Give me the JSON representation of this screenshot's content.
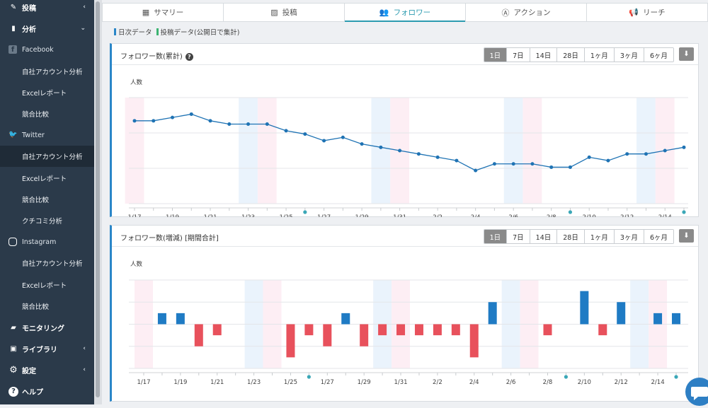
{
  "sidebar": {
    "items": [
      {
        "kind": "top",
        "icon": "pencil-icon",
        "label": "投稿",
        "chevron": "‹"
      },
      {
        "kind": "top",
        "icon": "bar-chart-icon",
        "label": "分析",
        "chevron": "⌄"
      },
      {
        "kind": "sec",
        "icon": "facebook-icon",
        "label": "Facebook",
        "color": "#3b5998"
      },
      {
        "kind": "sub",
        "label": "自社アカウント分析"
      },
      {
        "kind": "sub",
        "label": "Excelレポート"
      },
      {
        "kind": "sub",
        "label": "競合比較"
      },
      {
        "kind": "sec",
        "icon": "twitter-icon",
        "label": "Twitter",
        "color": "#5a6b7c"
      },
      {
        "kind": "sub",
        "label": "自社アカウント分析",
        "active": true
      },
      {
        "kind": "sub",
        "label": "Excelレポート"
      },
      {
        "kind": "sub",
        "label": "競合比較"
      },
      {
        "kind": "sub",
        "label": "クチコミ分析"
      },
      {
        "kind": "sec",
        "icon": "instagram-icon",
        "label": "Instagram",
        "color": "#2b3a4a"
      },
      {
        "kind": "sub",
        "label": "自社アカウント分析"
      },
      {
        "kind": "sub",
        "label": "Excelレポート"
      },
      {
        "kind": "sub",
        "label": "競合比較"
      },
      {
        "kind": "top",
        "icon": "chat-icon",
        "label": "モニタリング",
        "chevron": ""
      },
      {
        "kind": "top",
        "icon": "book-icon",
        "label": "ライブラリ",
        "chevron": "‹"
      },
      {
        "kind": "top",
        "icon": "gear-icon",
        "label": "設定",
        "chevron": "‹"
      },
      {
        "kind": "top",
        "icon": "question-icon",
        "label": "ヘルプ",
        "chevron": ""
      }
    ]
  },
  "tabs": [
    {
      "icon": "grid-icon",
      "glyph": "▦",
      "label": "サマリー"
    },
    {
      "icon": "image-icon",
      "glyph": "▨",
      "label": "投稿"
    },
    {
      "icon": "users-icon",
      "glyph": "👥",
      "label": "フォロワー",
      "active": true
    },
    {
      "icon": "action-icon",
      "glyph": "Ⓐ",
      "label": "アクション"
    },
    {
      "icon": "megaphone-icon",
      "glyph": "📢",
      "label": "リーチ"
    }
  ],
  "legend": [
    {
      "label": "日次データ",
      "color": "#2a86c8"
    },
    {
      "label": "投稿データ(公開日で集計)",
      "color": "#3cb371"
    }
  ],
  "periods": [
    "1日",
    "7日",
    "14日",
    "28日",
    "1ヶ月",
    "3ヶ月",
    "6ヶ月"
  ],
  "active_period": "1日",
  "colors": {
    "accent": "#2c9bb0",
    "line": "#1f73b4",
    "bar_pos": "#1f7bc4",
    "bar_neg": "#e8515c",
    "weekend_sat": "#eaf3fc",
    "weekend_sun": "#fdeef4",
    "marker": "#3aa7b7"
  },
  "panel1": {
    "title": "フォロワー数(累計)",
    "ylabel": "人数"
  },
  "panel2": {
    "title": "フォロワー数(増減) [期間合計]",
    "ylabel": "人数"
  },
  "chart_data": [
    {
      "type": "line",
      "title": "フォロワー数(累計)",
      "ylabel": "人数",
      "x": [
        "1/17",
        "1/18",
        "1/19",
        "1/20",
        "1/21",
        "1/22",
        "1/23",
        "1/24",
        "1/25",
        "1/26",
        "1/27",
        "1/28",
        "1/29",
        "1/30",
        "1/31",
        "2/1",
        "2/2",
        "2/3",
        "2/4",
        "2/5",
        "2/6",
        "2/7",
        "2/8",
        "2/9",
        "2/10",
        "2/11",
        "2/12",
        "2/13",
        "2/14",
        "2/15"
      ],
      "tick_labels": [
        "1/17",
        "1/19",
        "1/21",
        "1/23",
        "1/25",
        "1/27",
        "1/29",
        "1/31",
        "2/2",
        "2/4",
        "2/6",
        "2/8",
        "2/10",
        "2/12",
        "2/14"
      ],
      "values": [
        0.75,
        0.75,
        0.76,
        0.77,
        0.75,
        0.74,
        0.74,
        0.74,
        0.72,
        0.71,
        0.69,
        0.7,
        0.68,
        0.67,
        0.66,
        0.65,
        0.64,
        0.63,
        0.6,
        0.62,
        0.62,
        0.62,
        0.61,
        0.61,
        0.64,
        0.63,
        0.65,
        0.65,
        0.66,
        0.67
      ],
      "ylim": [
        0.5,
        0.82
      ],
      "post_markers": [
        "1/26",
        "2/9",
        "2/15"
      ],
      "shaded_weekends": {
        "sat": [
          "1/23",
          "1/30",
          "2/6",
          "2/13"
        ],
        "sun": [
          "1/17",
          "1/24",
          "1/31",
          "2/7",
          "2/14"
        ]
      }
    },
    {
      "type": "bar",
      "title": "フォロワー数(増減) [期間合計]",
      "ylabel": "人数",
      "x": [
        "1/17",
        "1/18",
        "1/19",
        "1/20",
        "1/21",
        "1/22",
        "1/23",
        "1/24",
        "1/25",
        "1/26",
        "1/27",
        "1/28",
        "1/29",
        "1/30",
        "1/31",
        "2/1",
        "2/2",
        "2/3",
        "2/4",
        "2/5",
        "2/6",
        "2/7",
        "2/8",
        "2/9",
        "2/10",
        "2/11",
        "2/12",
        "2/13",
        "2/14",
        "2/15"
      ],
      "tick_labels": [
        "1/17",
        "1/19",
        "1/21",
        "1/23",
        "1/25",
        "1/27",
        "1/29",
        "1/31",
        "2/2",
        "2/4",
        "2/6",
        "2/8",
        "2/10",
        "2/12",
        "2/14"
      ],
      "values": [
        0,
        1,
        1,
        -2,
        -1,
        0,
        0,
        0,
        -3,
        -1,
        -2,
        1,
        -2,
        -1,
        -1,
        -1,
        -1,
        -1,
        -3,
        2,
        0,
        0,
        -1,
        0,
        3,
        -1,
        2,
        0,
        1,
        1
      ],
      "ylim": [
        -4,
        4
      ],
      "post_markers": [
        "1/26",
        "2/9",
        "2/15"
      ],
      "shaded_weekends": {
        "sat": [
          "1/23",
          "1/30",
          "2/6",
          "2/13"
        ],
        "sun": [
          "1/17",
          "1/24",
          "1/31",
          "2/7",
          "2/14"
        ]
      }
    }
  ]
}
